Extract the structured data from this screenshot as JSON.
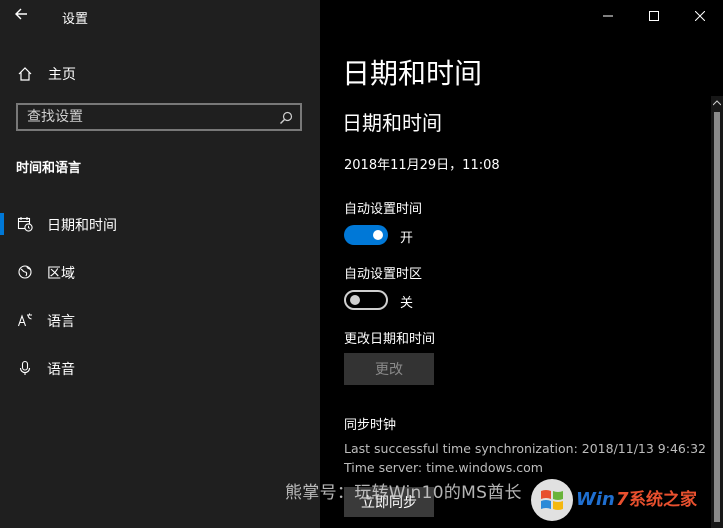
{
  "window": {
    "title": "设置"
  },
  "sidebar": {
    "home_label": "主页",
    "search_placeholder": "查找设置",
    "section_heading": "时间和语言",
    "items": [
      {
        "label": "日期和时间",
        "icon": "calendar-clock-icon",
        "active": true
      },
      {
        "label": "区域",
        "icon": "globe-icon",
        "active": false
      },
      {
        "label": "语言",
        "icon": "language-icon",
        "active": false
      },
      {
        "label": "语音",
        "icon": "microphone-icon",
        "active": false
      }
    ]
  },
  "main": {
    "page_title": "日期和时间",
    "section_title": "日期和时间",
    "current_datetime": "2018年11月29日，11:08",
    "auto_time": {
      "label": "自动设置时间",
      "state_label": "开",
      "on": true
    },
    "auto_timezone": {
      "label": "自动设置时区",
      "state_label": "关",
      "on": false
    },
    "change_datetime": {
      "label": "更改日期和时间",
      "button": "更改"
    },
    "sync": {
      "heading": "同步时钟",
      "last_sync": "Last successful time synchronization: 2018/11/13 9:46:32",
      "time_server": "Time server: time.windows.com",
      "button": "立即同步"
    }
  },
  "overlay": {
    "watermark": "熊掌号：玩转Win10的MS酋长",
    "logo_text": "Win7系统之家"
  },
  "colors": {
    "accent": "#0078d7",
    "sidebar_bg": "#1f1f1f",
    "main_bg": "#000000"
  }
}
